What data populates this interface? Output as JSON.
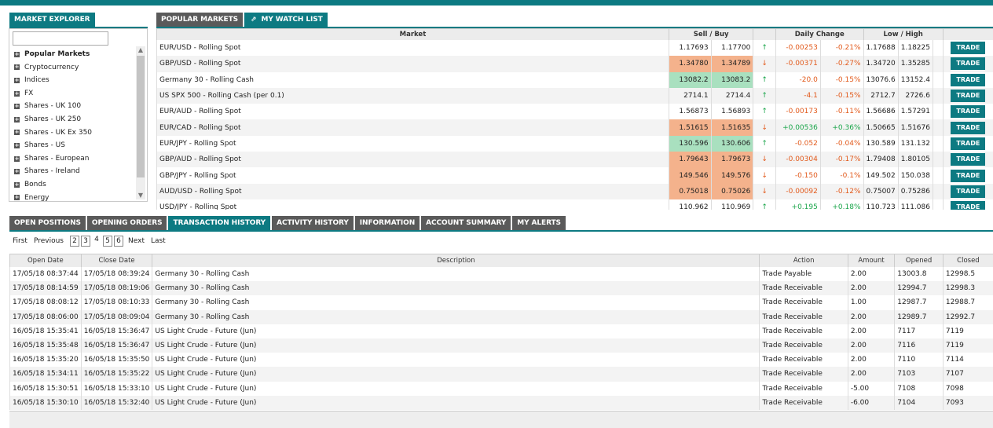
{
  "explorer": {
    "tab_label": "MARKET EXPLORER",
    "items": [
      {
        "label": "Popular Markets",
        "bold": true
      },
      {
        "label": "Cryptocurrency"
      },
      {
        "label": "Indices"
      },
      {
        "label": "FX"
      },
      {
        "label": "Shares - UK 100"
      },
      {
        "label": "Shares - UK 250"
      },
      {
        "label": "Shares - UK Ex 350"
      },
      {
        "label": "Shares - US"
      },
      {
        "label": "Shares - European"
      },
      {
        "label": "Shares - Ireland"
      },
      {
        "label": "Bonds"
      },
      {
        "label": "Energy"
      }
    ]
  },
  "markets": {
    "tabs": [
      {
        "label": "POPULAR MARKETS",
        "active": false
      },
      {
        "label": "MY WATCH LIST",
        "active": true,
        "icon": "pin-icon"
      }
    ],
    "headers": {
      "market": "Market",
      "sell_buy": "Sell / Buy",
      "daily_change": "Daily Change",
      "low_high": "Low / High"
    },
    "trade_label": "TRADE",
    "rows": [
      {
        "market": "EUR/USD - Rolling Spot",
        "sell": "1.17693",
        "buy": "1.17700",
        "hl": "",
        "dir": "up",
        "chg": "-0.00253",
        "pct": "-0.21%",
        "cdir": "neg",
        "low": "1.17688",
        "high": "1.18225"
      },
      {
        "market": "GBP/USD - Rolling Spot",
        "sell": "1.34780",
        "buy": "1.34789",
        "hl": "orange",
        "dir": "down",
        "chg": "-0.00371",
        "pct": "-0.27%",
        "cdir": "neg",
        "low": "1.34720",
        "high": "1.35285"
      },
      {
        "market": "Germany 30 - Rolling Cash",
        "sell": "13082.2",
        "buy": "13083.2",
        "hl": "green",
        "dir": "up",
        "chg": "-20.0",
        "pct": "-0.15%",
        "cdir": "neg",
        "low": "13076.6",
        "high": "13152.4"
      },
      {
        "market": "US SPX 500 - Rolling Cash (per 0.1)",
        "sell": "2714.1",
        "buy": "2714.4",
        "hl": "",
        "dir": "up",
        "chg": "-4.1",
        "pct": "-0.15%",
        "cdir": "neg",
        "low": "2712.7",
        "high": "2726.6"
      },
      {
        "market": "EUR/AUD - Rolling Spot",
        "sell": "1.56873",
        "buy": "1.56893",
        "hl": "",
        "dir": "up",
        "chg": "-0.00173",
        "pct": "-0.11%",
        "cdir": "neg",
        "low": "1.56686",
        "high": "1.57291"
      },
      {
        "market": "EUR/CAD - Rolling Spot",
        "sell": "1.51615",
        "buy": "1.51635",
        "hl": "orange",
        "dir": "down",
        "chg": "+0.00536",
        "pct": "+0.36%",
        "cdir": "pos",
        "low": "1.50665",
        "high": "1.51676"
      },
      {
        "market": "EUR/JPY - Rolling Spot",
        "sell": "130.596",
        "buy": "130.606",
        "hl": "green",
        "dir": "up",
        "chg": "-0.052",
        "pct": "-0.04%",
        "cdir": "neg",
        "low": "130.589",
        "high": "131.132"
      },
      {
        "market": "GBP/AUD - Rolling Spot",
        "sell": "1.79643",
        "buy": "1.79673",
        "hl": "orange",
        "dir": "down",
        "chg": "-0.00304",
        "pct": "-0.17%",
        "cdir": "neg",
        "low": "1.79408",
        "high": "1.80105"
      },
      {
        "market": "GBP/JPY - Rolling Spot",
        "sell": "149.546",
        "buy": "149.576",
        "hl": "orange",
        "dir": "down",
        "chg": "-0.150",
        "pct": "-0.1%",
        "cdir": "neg",
        "low": "149.502",
        "high": "150.038"
      },
      {
        "market": "AUD/USD - Rolling Spot",
        "sell": "0.75018",
        "buy": "0.75026",
        "hl": "orange",
        "dir": "down",
        "chg": "-0.00092",
        "pct": "-0.12%",
        "cdir": "neg",
        "low": "0.75007",
        "high": "0.75286"
      },
      {
        "market": "USD/JPY - Rolling Spot",
        "sell": "110.962",
        "buy": "110.969",
        "hl": "",
        "dir": "up",
        "chg": "+0.195",
        "pct": "+0.18%",
        "cdir": "pos",
        "low": "110.723",
        "high": "111.086"
      }
    ]
  },
  "bottom": {
    "tabs": [
      {
        "label": "OPEN POSITIONS",
        "active": false
      },
      {
        "label": "OPENING ORDERS",
        "active": false
      },
      {
        "label": "TRANSACTION HISTORY",
        "active": true
      },
      {
        "label": "ACTIVITY HISTORY",
        "active": false
      },
      {
        "label": "INFORMATION",
        "active": false
      },
      {
        "label": "ACCOUNT SUMMARY",
        "active": false
      },
      {
        "label": "MY ALERTS",
        "active": false
      }
    ],
    "pager": {
      "first": "First",
      "previous": "Previous",
      "pages": [
        "2",
        "3",
        "4",
        "5",
        "6"
      ],
      "current": "4",
      "next": "Next",
      "last": "Last"
    },
    "headers": {
      "open_date": "Open Date",
      "close_date": "Close Date",
      "description": "Description",
      "action": "Action",
      "amount": "Amount",
      "opened": "Opened",
      "closed": "Closed"
    },
    "rows": [
      {
        "open": "17/05/18 08:37:44",
        "close": "17/05/18 08:39:24",
        "desc": "Germany 30 - Rolling Cash",
        "action": "Trade Payable",
        "amount": "2.00",
        "opened": "13003.8",
        "closed": "12998.5"
      },
      {
        "open": "17/05/18 08:14:59",
        "close": "17/05/18 08:19:06",
        "desc": "Germany 30 - Rolling Cash",
        "action": "Trade Receivable",
        "amount": "2.00",
        "opened": "12994.7",
        "closed": "12998.3"
      },
      {
        "open": "17/05/18 08:08:12",
        "close": "17/05/18 08:10:33",
        "desc": "Germany 30 - Rolling Cash",
        "action": "Trade Receivable",
        "amount": "1.00",
        "opened": "12987.7",
        "closed": "12988.7"
      },
      {
        "open": "17/05/18 08:06:00",
        "close": "17/05/18 08:09:04",
        "desc": "Germany 30 - Rolling Cash",
        "action": "Trade Receivable",
        "amount": "2.00",
        "opened": "12989.7",
        "closed": "12992.7"
      },
      {
        "open": "16/05/18 15:35:41",
        "close": "16/05/18 15:36:47",
        "desc": "US Light Crude - Future (Jun)",
        "action": "Trade Receivable",
        "amount": "2.00",
        "opened": "7117",
        "closed": "7119"
      },
      {
        "open": "16/05/18 15:35:48",
        "close": "16/05/18 15:36:47",
        "desc": "US Light Crude - Future (Jun)",
        "action": "Trade Receivable",
        "amount": "2.00",
        "opened": "7116",
        "closed": "7119"
      },
      {
        "open": "16/05/18 15:35:20",
        "close": "16/05/18 15:35:50",
        "desc": "US Light Crude - Future (Jun)",
        "action": "Trade Receivable",
        "amount": "2.00",
        "opened": "7110",
        "closed": "7114"
      },
      {
        "open": "16/05/18 15:34:11",
        "close": "16/05/18 15:35:22",
        "desc": "US Light Crude - Future (Jun)",
        "action": "Trade Receivable",
        "amount": "2.00",
        "opened": "7103",
        "closed": "7107"
      },
      {
        "open": "16/05/18 15:30:51",
        "close": "16/05/18 15:33:10",
        "desc": "US Light Crude - Future (Jun)",
        "action": "Trade Receivable",
        "amount": "-5.00",
        "opened": "7108",
        "closed": "7098"
      },
      {
        "open": "16/05/18 15:30:10",
        "close": "16/05/18 15:32:40",
        "desc": "US Light Crude - Future (Jun)",
        "action": "Trade Receivable",
        "amount": "-6.00",
        "opened": "7104",
        "closed": "7093"
      }
    ]
  }
}
